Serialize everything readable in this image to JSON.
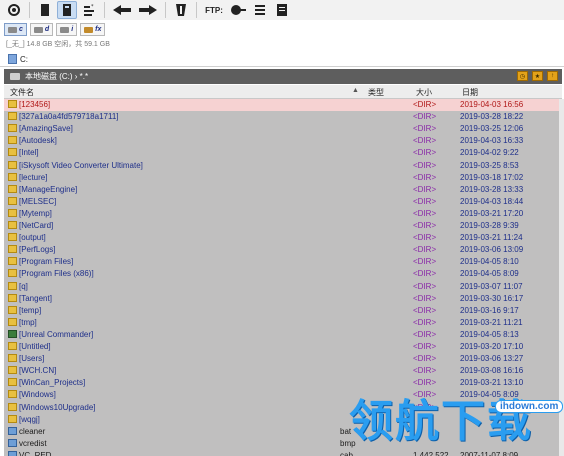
{
  "toolbar": {
    "ftp_label": "FTP:"
  },
  "drives": [
    {
      "letter": "c"
    },
    {
      "letter": "d"
    },
    {
      "letter": "i"
    },
    {
      "letter": "fx"
    }
  ],
  "free_space": "[_无_]  14.8 GB 空闲，共 59.1 GB",
  "tab": {
    "label": "C:"
  },
  "path": {
    "text": "本地磁盘 (C:) › *.*"
  },
  "columns": {
    "name": "文件名",
    "ext": "类型",
    "size": "大小",
    "date": "日期"
  },
  "files": [
    {
      "name": "[123456]",
      "ext": "",
      "size": "<DIR>",
      "date": "2019-04-03 16:56",
      "kind": "dir",
      "selected": true
    },
    {
      "name": "[327a1a0a4fd579718a1711]",
      "ext": "",
      "size": "<DIR>",
      "date": "2019-03-28 18:22",
      "kind": "dir"
    },
    {
      "name": "[AmazingSave]",
      "ext": "",
      "size": "<DIR>",
      "date": "2019-03-25 12:06",
      "kind": "dir"
    },
    {
      "name": "[Autodesk]",
      "ext": "",
      "size": "<DIR>",
      "date": "2019-04-03 16:33",
      "kind": "dir"
    },
    {
      "name": "[Intel]",
      "ext": "",
      "size": "<DIR>",
      "date": "2019-04-02 9:22",
      "kind": "dir"
    },
    {
      "name": "[iSkysoft Video Converter Ultimate]",
      "ext": "",
      "size": "<DIR>",
      "date": "2019-03-25 8:53",
      "kind": "dir"
    },
    {
      "name": "[lecture]",
      "ext": "",
      "size": "<DIR>",
      "date": "2019-03-18 17:02",
      "kind": "dir"
    },
    {
      "name": "[ManageEngine]",
      "ext": "",
      "size": "<DIR>",
      "date": "2019-03-28 13:33",
      "kind": "dir"
    },
    {
      "name": "[MELSEC]",
      "ext": "",
      "size": "<DIR>",
      "date": "2019-04-03 18:44",
      "kind": "dir"
    },
    {
      "name": "[Mytemp]",
      "ext": "",
      "size": "<DIR>",
      "date": "2019-03-21 17:20",
      "kind": "dir"
    },
    {
      "name": "[NetCard]",
      "ext": "",
      "size": "<DIR>",
      "date": "2019-03-28 9:39",
      "kind": "dir"
    },
    {
      "name": "[output]",
      "ext": "",
      "size": "<DIR>",
      "date": "2019-03-21 11:24",
      "kind": "dir"
    },
    {
      "name": "[PerfLogs]",
      "ext": "",
      "size": "<DIR>",
      "date": "2019-03-06 13:09",
      "kind": "dir"
    },
    {
      "name": "[Program Files]",
      "ext": "",
      "size": "<DIR>",
      "date": "2019-04-05 8:10",
      "kind": "dir"
    },
    {
      "name": "[Program Files (x86)]",
      "ext": "",
      "size": "<DIR>",
      "date": "2019-04-05 8:09",
      "kind": "dir"
    },
    {
      "name": "[q]",
      "ext": "",
      "size": "<DIR>",
      "date": "2019-03-07 11:07",
      "kind": "dir"
    },
    {
      "name": "[Tangent]",
      "ext": "",
      "size": "<DIR>",
      "date": "2019-03-30 16:17",
      "kind": "dir"
    },
    {
      "name": "[temp]",
      "ext": "",
      "size": "<DIR>",
      "date": "2019-03-16 9:17",
      "kind": "dir"
    },
    {
      "name": "[tmp]",
      "ext": "",
      "size": "<DIR>",
      "date": "2019-03-21 11:21",
      "kind": "dir"
    },
    {
      "name": "[Unreal Commander]",
      "ext": "",
      "size": "<DIR>",
      "date": "2019-04-05 8:13",
      "kind": "app"
    },
    {
      "name": "[Untitled]",
      "ext": "",
      "size": "<DIR>",
      "date": "2019-03-20 17:10",
      "kind": "dir"
    },
    {
      "name": "[Users]",
      "ext": "",
      "size": "<DIR>",
      "date": "2019-03-06 13:27",
      "kind": "dir"
    },
    {
      "name": "[WCH.CN]",
      "ext": "",
      "size": "<DIR>",
      "date": "2019-03-08 16:16",
      "kind": "dir"
    },
    {
      "name": "[WinCan_Projects]",
      "ext": "",
      "size": "<DIR>",
      "date": "2019-03-21 13:10",
      "kind": "dir"
    },
    {
      "name": "[Windows]",
      "ext": "",
      "size": "<DIR>",
      "date": "2019-04-05 8:09",
      "kind": "dir"
    },
    {
      "name": "[Windows10Upgrade]",
      "ext": "",
      "size": "<DIR>",
      "date": "",
      "kind": "dir"
    },
    {
      "name": "[wqgj]",
      "ext": "",
      "size": "",
      "date": "",
      "kind": "dir"
    },
    {
      "name": "cleaner",
      "ext": "bat",
      "size": "",
      "date": "",
      "kind": "file"
    },
    {
      "name": "vcredist",
      "ext": "bmp",
      "size": "",
      "date": "",
      "kind": "file"
    },
    {
      "name": "VC_RED",
      "ext": "cab",
      "size": "1,442,522",
      "date": "2007-11-07 8:09",
      "kind": "file"
    }
  ],
  "watermark": {
    "glyphs": [
      "领",
      "航",
      "下",
      "载"
    ],
    "url": "ihdown.com"
  }
}
